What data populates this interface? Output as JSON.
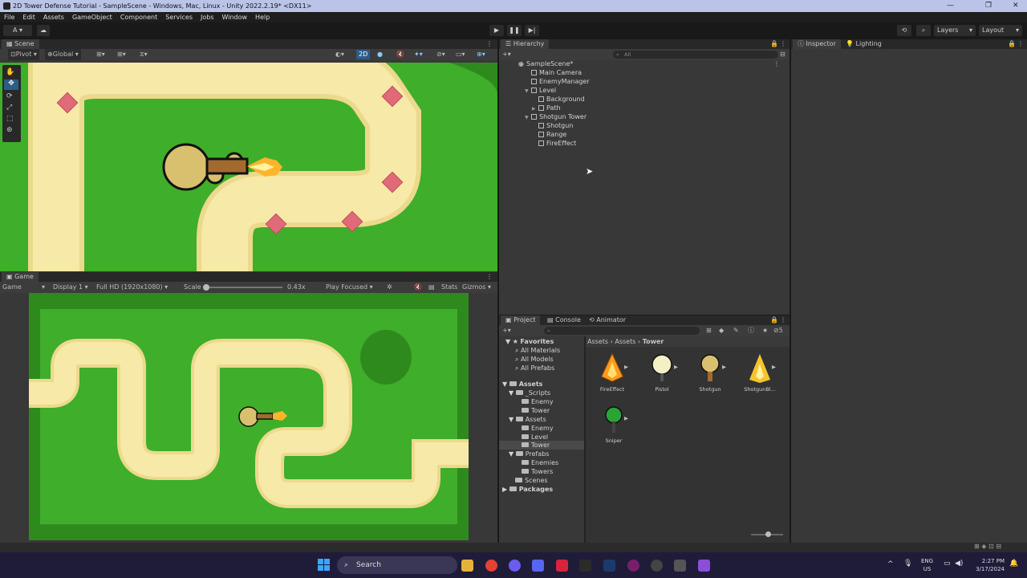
{
  "window": {
    "title": "2D Tower Defense Tutorial - SampleScene - Windows, Mac, Linux - Unity 2022.2.19* <DX11>"
  },
  "menu": [
    "File",
    "Edit",
    "Assets",
    "GameObject",
    "Component",
    "Services",
    "Jobs",
    "Window",
    "Help"
  ],
  "toolbar": {
    "account": "A",
    "layers": "Layers",
    "layout": "Layout"
  },
  "scene": {
    "tab": "Scene",
    "pivot": "Pivot",
    "global": "Global",
    "mode_2d": "2D"
  },
  "game": {
    "tab": "Game",
    "display_mode": "Game",
    "display": "Display 1",
    "resolution": "Full HD (1920x1080)",
    "scale_label": "Scale",
    "scale_value": "0.43x",
    "play_focused": "Play Focused",
    "stats": "Stats",
    "gizmos": "Gizmos"
  },
  "hierarchy": {
    "tab": "Hierarchy",
    "search_placeholder": "All",
    "items": [
      {
        "label": "SampleScene*"
      },
      {
        "label": "Main Camera"
      },
      {
        "label": "EnemyManager"
      },
      {
        "label": "Level"
      },
      {
        "label": "Background"
      },
      {
        "label": "Path"
      },
      {
        "label": "Shotgun Tower"
      },
      {
        "label": "Shotgun"
      },
      {
        "label": "Range"
      },
      {
        "label": "FireEffect"
      }
    ]
  },
  "inspector": {
    "tab": "Inspector",
    "lighting_tab": "Lighting"
  },
  "project": {
    "tab": "Project",
    "console_tab": "Console",
    "animator_tab": "Animator",
    "hidden_count": "5",
    "breadcrumb": [
      "Assets",
      "Assets",
      "Tower"
    ],
    "tree": [
      {
        "label": "Favorites"
      },
      {
        "label": "All Materials"
      },
      {
        "label": "All Models"
      },
      {
        "label": "All Prefabs"
      },
      {
        "label": "Assets"
      },
      {
        "label": "_Scripts"
      },
      {
        "label": "Enemy"
      },
      {
        "label": "Tower"
      },
      {
        "label": "Assets"
      },
      {
        "label": "Enemy"
      },
      {
        "label": "Level"
      },
      {
        "label": "Tower"
      },
      {
        "label": "Prefabs"
      },
      {
        "label": "Enemies"
      },
      {
        "label": "Towers"
      },
      {
        "label": "Scenes"
      },
      {
        "label": "Packages"
      }
    ],
    "assets": [
      {
        "label": "FireEffect"
      },
      {
        "label": "Pistol"
      },
      {
        "label": "Shotgun"
      },
      {
        "label": "ShotgunBl..."
      },
      {
        "label": "Sniper"
      }
    ]
  },
  "taskbar": {
    "search": "Search",
    "lang": "ENG",
    "region": "US",
    "time": "2:27 PM",
    "date": "3/17/2024"
  },
  "colors": {
    "grass": "#3fae2a",
    "path": "#f7e9a8",
    "path_edge": "#ecd98d",
    "tower": "#d9c06e",
    "crystal": "#e06a78",
    "accent_blue": "#2c5d87"
  }
}
